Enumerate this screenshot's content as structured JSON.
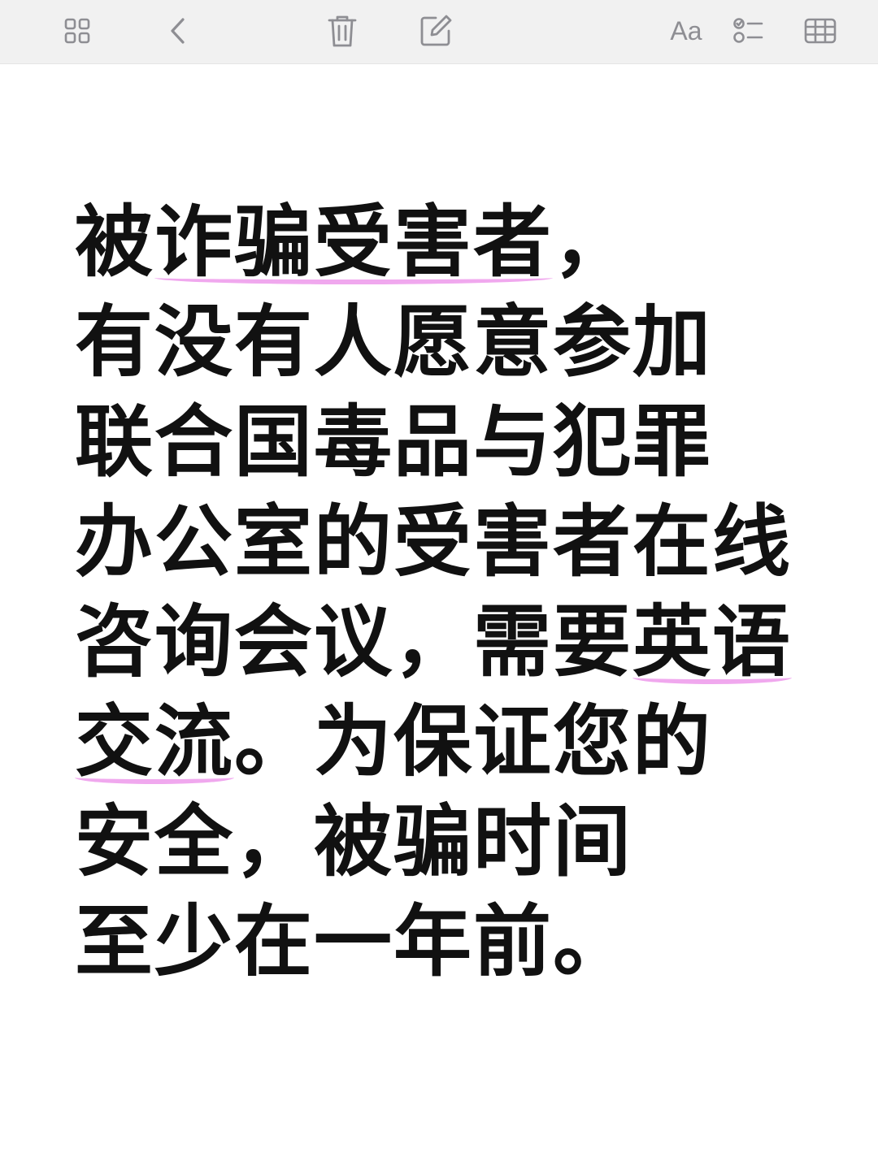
{
  "toolbar": {
    "items": [
      {
        "name": "gallery-view-icon"
      },
      {
        "name": "back-chevron-icon"
      },
      {
        "name": "trash-icon"
      },
      {
        "name": "compose-icon"
      },
      {
        "name": "format-text-icon",
        "label": "Aa"
      },
      {
        "name": "checklist-icon"
      },
      {
        "name": "table-icon"
      }
    ],
    "format_label": "Aa",
    "icon_color": "#8e8e93"
  },
  "note": {
    "lines": [
      {
        "pre": "被",
        "hl": "诈骗受害者",
        "post": "，"
      },
      {
        "pre": "有没有人愿意参加",
        "hl": "",
        "post": ""
      },
      {
        "pre": "联合国毒品与犯罪",
        "hl": "",
        "post": ""
      },
      {
        "pre": "办公室的受害者在线",
        "hl": "",
        "post": ""
      },
      {
        "pre": "咨询会议，需要",
        "hl": "英语",
        "post": ""
      },
      {
        "pre": "",
        "hl": "交流",
        "post": "。为保证您的"
      },
      {
        "pre": "安全，被骗时间",
        "hl": "",
        "post": ""
      },
      {
        "pre": "至少在一年前。",
        "hl": "",
        "post": ""
      }
    ],
    "highlight_color": "#f0a8ee",
    "text_color": "#111111"
  }
}
